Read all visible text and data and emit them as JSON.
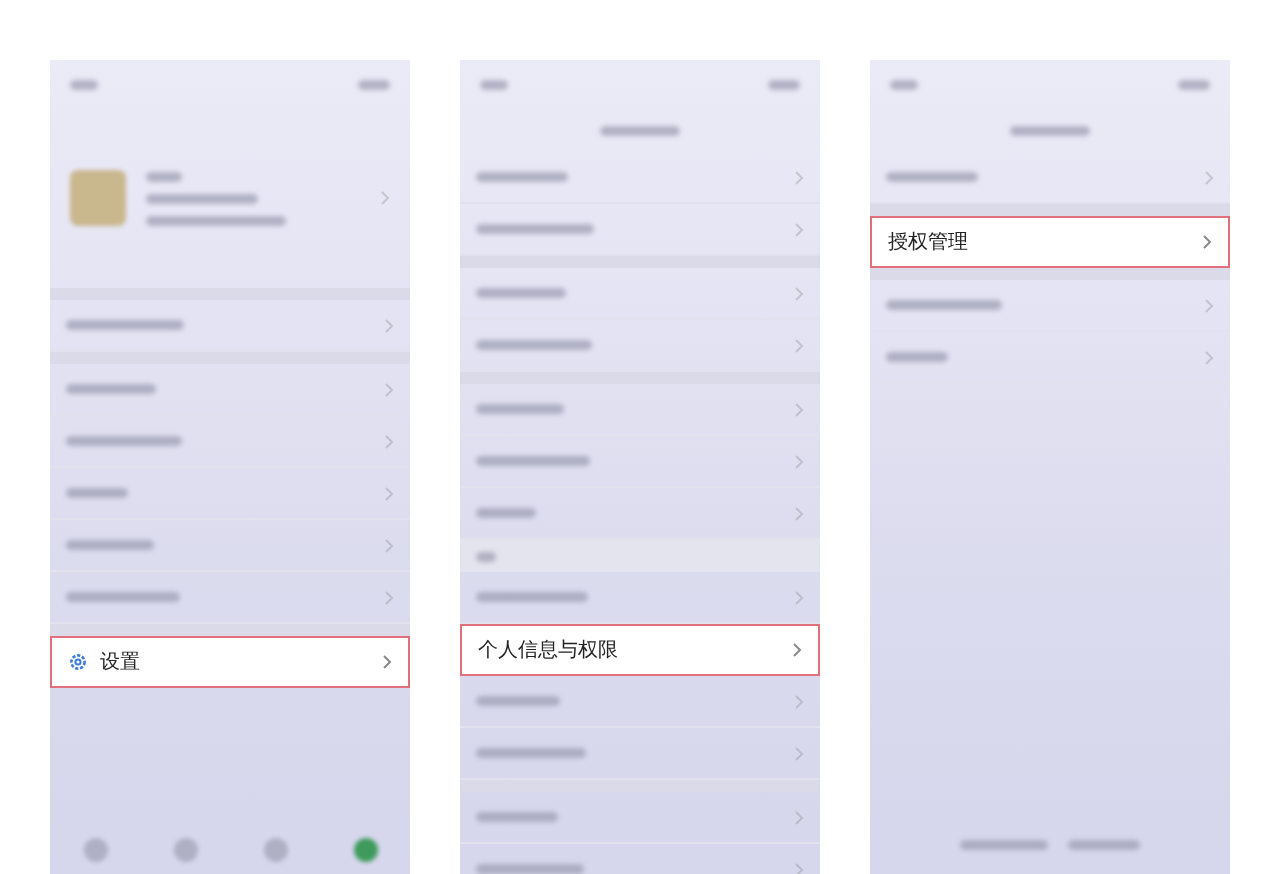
{
  "screens": [
    {
      "rows": [
        {
          "kind": "status"
        },
        {
          "kind": "profile"
        },
        {
          "kind": "gap"
        },
        {
          "kind": "item"
        },
        {
          "kind": "gap"
        },
        {
          "kind": "item"
        },
        {
          "kind": "item"
        },
        {
          "kind": "item"
        },
        {
          "kind": "item"
        },
        {
          "kind": "item"
        },
        {
          "kind": "gap"
        },
        {
          "kind": "highlight-gear",
          "label": "设置"
        },
        {
          "kind": "spacer"
        },
        {
          "kind": "tabbar"
        }
      ]
    },
    {
      "rows": [
        {
          "kind": "status"
        },
        {
          "kind": "nav"
        },
        {
          "kind": "item"
        },
        {
          "kind": "item"
        },
        {
          "kind": "gap"
        },
        {
          "kind": "item"
        },
        {
          "kind": "item"
        },
        {
          "kind": "gap"
        },
        {
          "kind": "item"
        },
        {
          "kind": "item"
        },
        {
          "kind": "item"
        },
        {
          "kind": "section"
        },
        {
          "kind": "item"
        },
        {
          "kind": "highlight",
          "label": "个人信息与权限"
        },
        {
          "kind": "item"
        },
        {
          "kind": "item"
        },
        {
          "kind": "gap"
        },
        {
          "kind": "item"
        },
        {
          "kind": "item"
        }
      ]
    },
    {
      "rows": [
        {
          "kind": "status"
        },
        {
          "kind": "nav"
        },
        {
          "kind": "item"
        },
        {
          "kind": "gap"
        },
        {
          "kind": "highlight",
          "label": "授权管理"
        },
        {
          "kind": "gap"
        },
        {
          "kind": "item"
        },
        {
          "kind": "item"
        },
        {
          "kind": "spacer"
        },
        {
          "kind": "footer"
        }
      ]
    }
  ]
}
